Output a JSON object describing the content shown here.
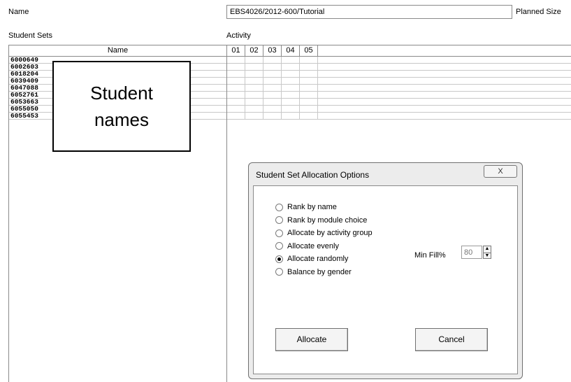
{
  "form": {
    "name_label": "Name",
    "name_value": "EBS4026/2012-600/Tutorial",
    "planned_size_label": "Planned Size",
    "student_sets_label": "Student Sets",
    "activity_label": "Activity"
  },
  "student_table": {
    "header": "Name",
    "rows": [
      "6000649",
      "6002603",
      "6018204",
      "6039409",
      "6047088",
      "6052761",
      "6053663",
      "6055050",
      "6055453"
    ]
  },
  "activity_table": {
    "columns": [
      "01",
      "02",
      "03",
      "04",
      "05"
    ]
  },
  "callout": {
    "line1": "Student",
    "line2": "names"
  },
  "dialog": {
    "title": "Student Set Allocation Options",
    "close_glyph": "X",
    "options": [
      {
        "label": "Rank by name",
        "selected": false
      },
      {
        "label": "Rank by module choice",
        "selected": false
      },
      {
        "label": "Allocate by activity group",
        "selected": false
      },
      {
        "label": "Allocate evenly",
        "selected": false
      },
      {
        "label": "Allocate randomly",
        "selected": true
      },
      {
        "label": "Balance by gender",
        "selected": false
      }
    ],
    "min_fill_label": "Min Fill%",
    "min_fill_value": "80",
    "allocate_label": "Allocate",
    "cancel_label": "Cancel"
  }
}
